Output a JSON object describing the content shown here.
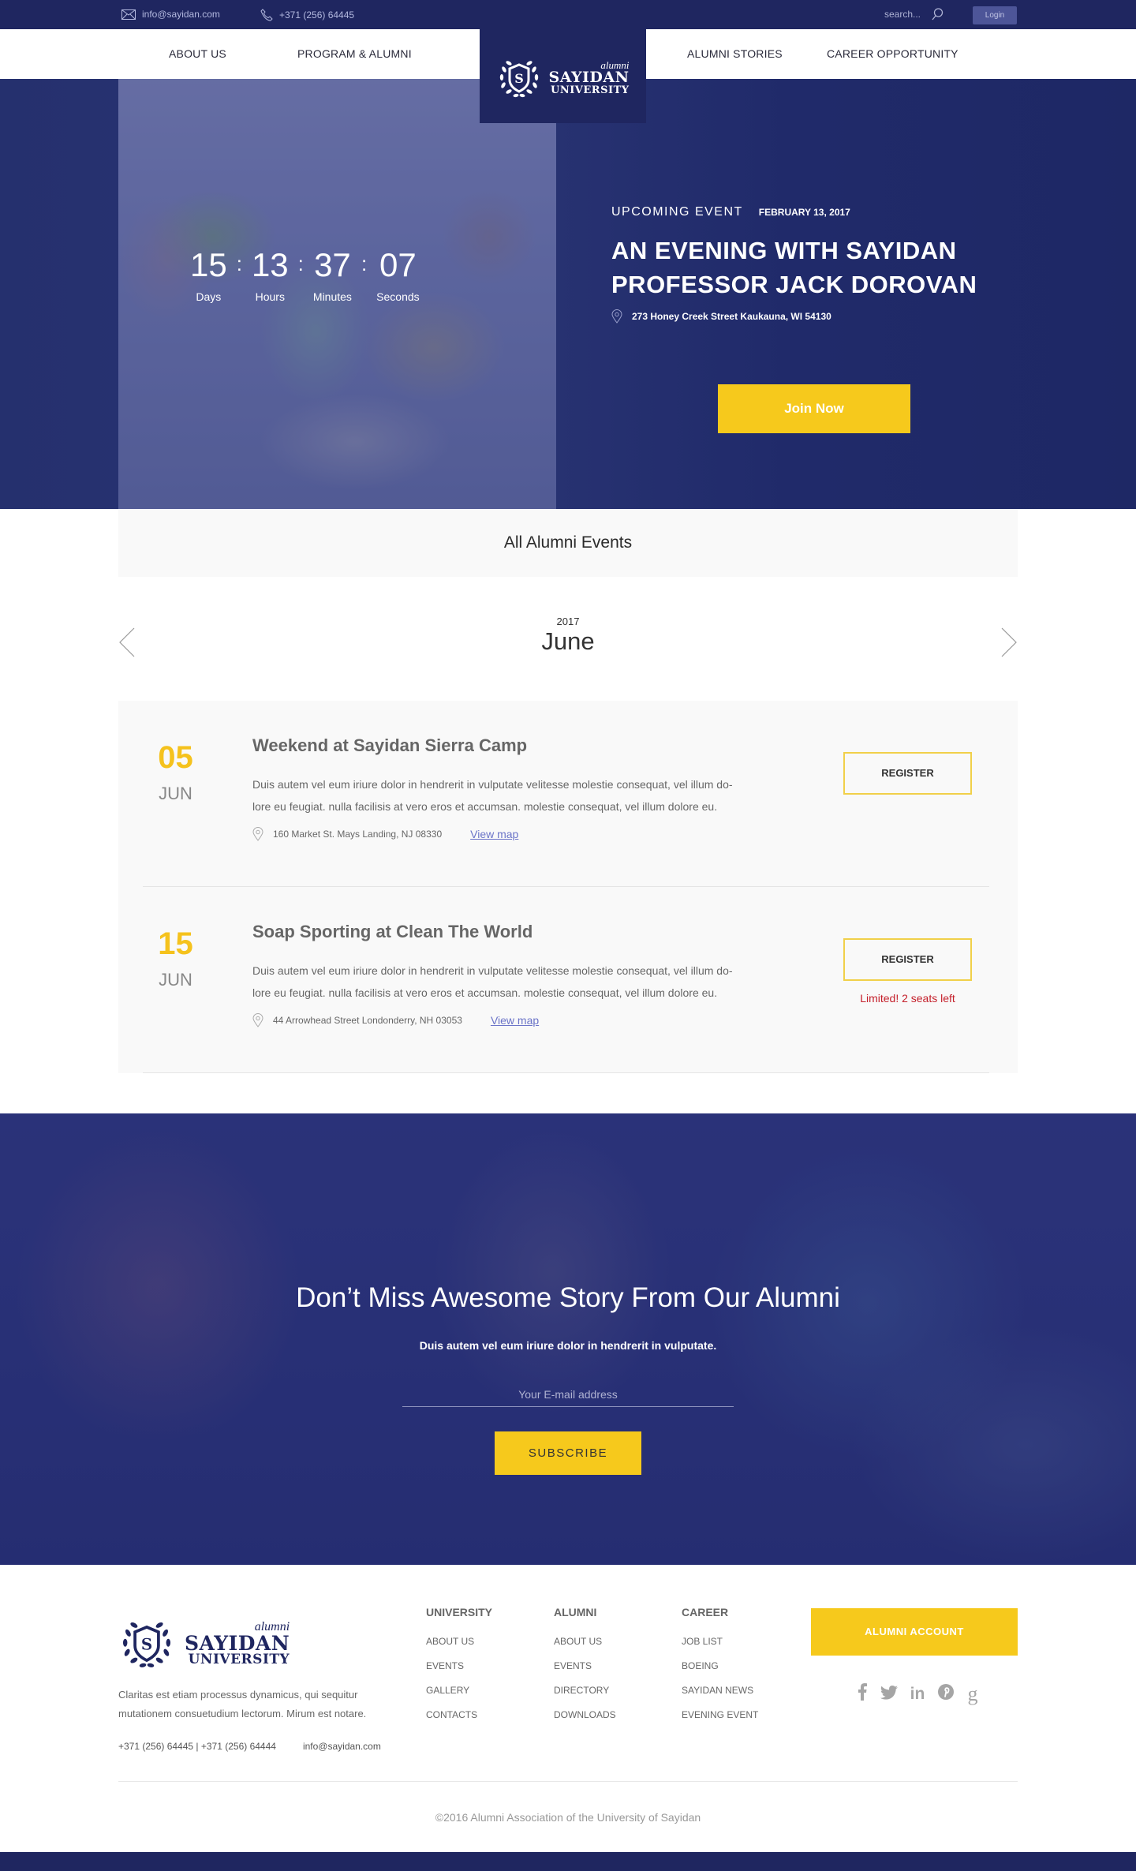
{
  "topbar": {
    "email": "info@sayidan.com",
    "phone": "+371 (256) 64445",
    "search_placeholder": "search...",
    "login_label": "Login"
  },
  "nav": {
    "items": [
      "ABOUT US",
      "PROGRAM & ALUMNI",
      "ALUMNI STORIES",
      "CAREER OPPORTUNITY"
    ]
  },
  "logo": {
    "script": "alumni",
    "name": "SAYIDAN",
    "sub": "UNIVERSITY",
    "badge_letter": "S"
  },
  "hero": {
    "countdown": [
      {
        "value": "15",
        "label": "Days"
      },
      {
        "value": "13",
        "label": "Hours"
      },
      {
        "value": "37",
        "label": "Minutes"
      },
      {
        "value": "07",
        "label": "Seconds"
      }
    ],
    "separator": ":",
    "kicker": "UPCOMING EVENT",
    "date": "FEBRUARY 13, 2017",
    "title_line1": "AN EVENING WITH SAYIDAN",
    "title_line2": "PROFESSOR JACK DOROVAN",
    "address": "273 Honey Creek Street Kaukauna, WI 54130",
    "cta_label": "Join Now"
  },
  "events_header": {
    "title": "All Alumni Events",
    "year": "2017",
    "month": "June"
  },
  "events": [
    {
      "day": "05",
      "month": "JUN",
      "title": "Weekend at Sayidan Sierra Camp",
      "desc_line1": "Duis autem vel eum iriure dolor in hendrerit in vulputate velitesse molestie consequat, vel illum do-",
      "desc_line2": "lore eu feugiat. nulla facilisis at vero eros et accumsan. molestie consequat, vel illum dolore eu.",
      "location": "160 Market St. Mays Landing, NJ 08330",
      "map_label": "View map",
      "register_label": "REGISTER",
      "notice": ""
    },
    {
      "day": "15",
      "month": "JUN",
      "title": "Soap Sporting at Clean The World",
      "desc_line1": "Duis autem vel eum iriure dolor in hendrerit in vulputate velitesse molestie consequat, vel illum do-",
      "desc_line2": "lore eu feugiat. nulla facilisis at vero eros et accumsan. molestie consequat, vel illum dolore eu.",
      "location": "44 Arrowhead Street Londonderry, NH 03053",
      "map_label": "View map",
      "register_label": "REGISTER",
      "notice": "Limited! 2 seats left"
    }
  ],
  "subscribe": {
    "title": "Don’t Miss Awesome Story From Our Alumni",
    "subtitle": "Duis autem vel eum iriure dolor in hendrerit in vulputate.",
    "email_placeholder": "Your E-mail address",
    "button_label": "SUBSCRIBE"
  },
  "footer": {
    "description_line1": "Claritas est etiam processus dynamicus, qui sequitur",
    "description_line2": "mutationem consuetudium lectorum. Mirum est notare.",
    "phones": "+371 (256) 64445 | +371 (256) 64444",
    "email": "info@sayidan.com",
    "columns": [
      {
        "title": "UNIVERSITY",
        "links": [
          "ABOUT US",
          "EVENTS",
          "GALLERY",
          "CONTACTS"
        ]
      },
      {
        "title": "ALUMNI",
        "links": [
          "ABOUT US",
          "EVENTS",
          "DIRECTORY",
          "DOWNLOADS"
        ]
      },
      {
        "title": "CAREER",
        "links": [
          "JOB LIST",
          "BOEING",
          "SAYIDAN NEWS",
          "EVENING EVENT"
        ]
      }
    ],
    "account_label": "ALUMNI ACCOUNT",
    "socials": [
      {
        "name": "facebook",
        "glyph": "f"
      },
      {
        "name": "twitter",
        "glyph": "🐦"
      },
      {
        "name": "linkedin",
        "glyph": "in"
      },
      {
        "name": "pinterest",
        "glyph": "℗"
      },
      {
        "name": "google-plus",
        "glyph": "g"
      }
    ],
    "copyright": "©2016 Alumni Association of the University of Sayidan"
  },
  "colors": {
    "navy": "#1f2660",
    "yellow": "#f6c91c",
    "alert_red": "#c41f2a",
    "link_blue": "#6b74c8"
  }
}
